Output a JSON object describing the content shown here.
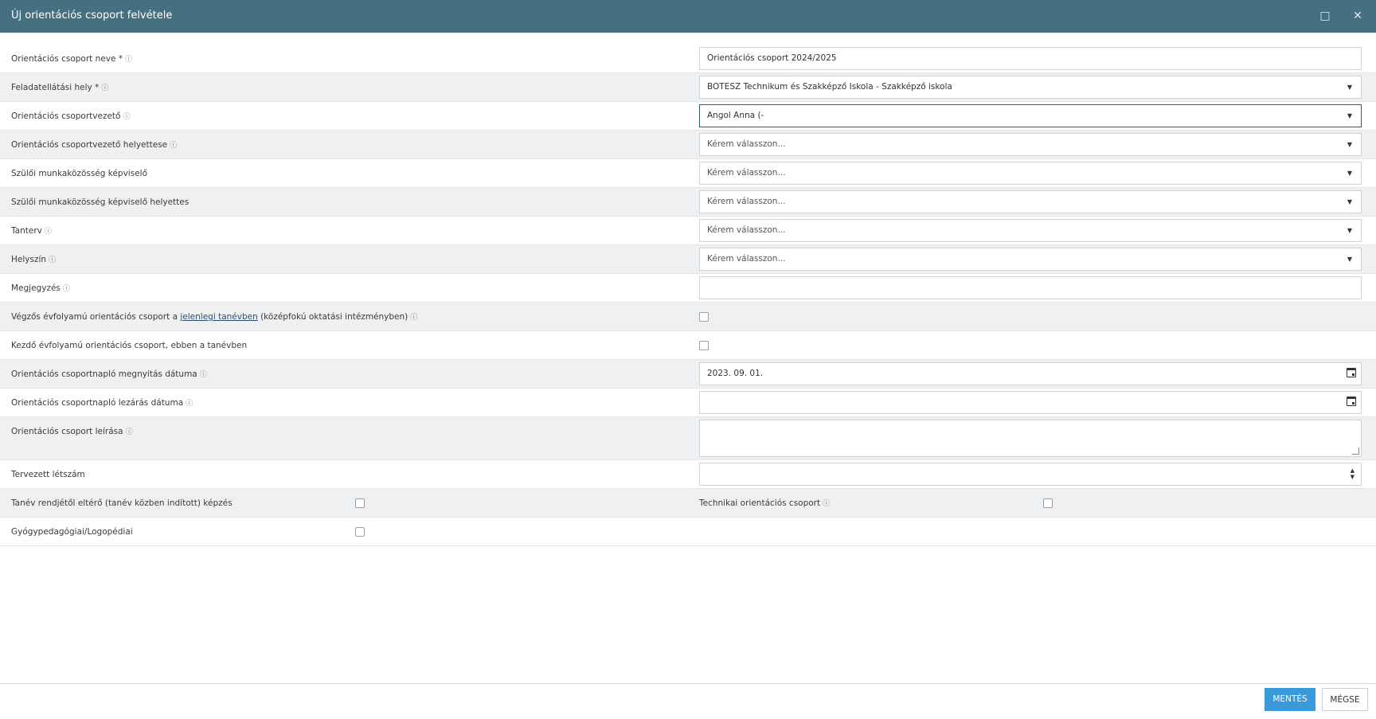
{
  "dialog": {
    "title": "Új orientációs csoport felvétele",
    "maximize_glyph": "□",
    "close_glyph": "✕"
  },
  "form": {
    "rows": [
      {
        "label": "Orientációs csoport neve *",
        "info": true,
        "type": "text",
        "value": "Orientációs csoport 2024/2025"
      },
      {
        "label": "Feladatellátási hely *",
        "info": true,
        "type": "select",
        "value": "BOTESZ Technikum és Szakképző Iskola - Szakképző iskola"
      },
      {
        "label": "Orientációs csoportvezető",
        "info": true,
        "type": "select",
        "value": "Angol Anna (-"
      },
      {
        "label": "Orientációs csoportvezető helyettese",
        "info": true,
        "type": "select",
        "placeholder": "Kérem válasszon..."
      },
      {
        "label": "Szülői munkaközösség képviselő",
        "info": false,
        "type": "select",
        "placeholder": "Kérem válasszon..."
      },
      {
        "label": "Szülői munkaközösség képviselő helyettes",
        "info": false,
        "type": "select",
        "placeholder": "Kérem válasszon..."
      },
      {
        "label": "Tanterv",
        "info": true,
        "type": "select",
        "placeholder": "Kérem válasszon..."
      },
      {
        "label": "Helyszín",
        "info": true,
        "type": "select",
        "placeholder": "Kérem válasszon..."
      },
      {
        "label": "Megjegyzés",
        "info": true,
        "type": "text",
        "value": ""
      },
      {
        "label_pre": "Végzős évfolyamú orientációs csoport a ",
        "label_link": "jelenlegi tanévben",
        "label_post": " (középfokú oktatási intézményben)",
        "info": true,
        "type": "checkbox",
        "checked": false
      },
      {
        "label": "Kezdő évfolyamú orientációs csoport, ebben a tanévben",
        "info": false,
        "type": "checkbox",
        "checked": false
      },
      {
        "label": "Orientációs csoportnapló megnyitás dátuma",
        "info": true,
        "type": "date",
        "value": "2023. 09. 01."
      },
      {
        "label": "Orientációs csoportnapló lezárás dátuma",
        "info": true,
        "type": "date",
        "value": ""
      },
      {
        "label": "Orientációs csoport leírása",
        "info": true,
        "type": "textarea",
        "value": ""
      },
      {
        "label": "Tervezett létszám",
        "info": false,
        "type": "number",
        "value": ""
      }
    ],
    "pair_row": {
      "left_label": "Tanév rendjétől eltérő (tanév közben indított) képzés",
      "right_label": "Technikai orientációs csoport"
    },
    "last_row": {
      "label": "Gyógypedagógiai/Logopédiai"
    },
    "info_glyph": "ⓘ"
  },
  "footer": {
    "save_label": "MENTÉS",
    "cancel_label": "MÉGSE"
  },
  "colors": {
    "titlebar": "#45707f",
    "primary_button": "#3a9ad9",
    "row_alt": "#eef0f2"
  }
}
